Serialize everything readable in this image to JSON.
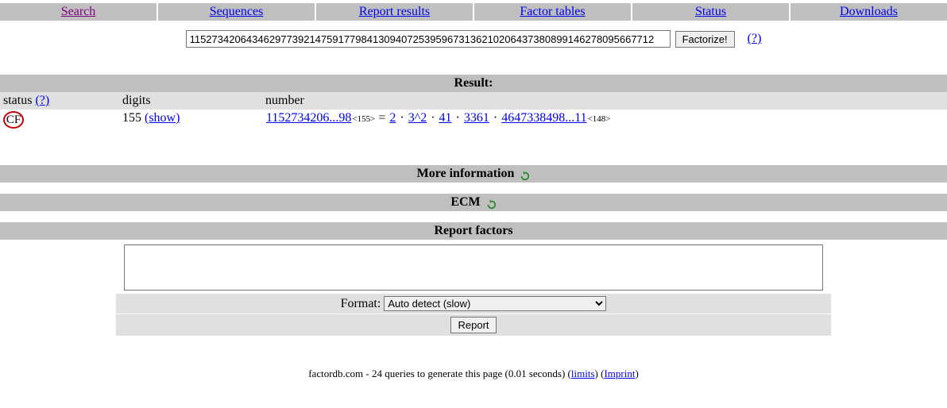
{
  "nav": {
    "search": "Search",
    "sequences": "Sequences",
    "report_results": "Report results",
    "factor_tables": "Factor tables",
    "status": "Status",
    "downloads": "Downloads"
  },
  "search": {
    "value": "115273420643462977392147591779841309407253959673136210206437380899146278095667712",
    "button": "Factorize!",
    "help": "(?)"
  },
  "result": {
    "heading": "Result:",
    "cols": {
      "status": "status",
      "status_help": "(?)",
      "digits": "digits",
      "number": "number"
    },
    "row": {
      "cf": "CF",
      "digits": "155",
      "show": "(show)",
      "num_prefix": "1152734206...98",
      "num_sub": "<155>",
      "eq": " = ",
      "f1": "2",
      "dot": " · ",
      "f2": "3^2",
      "f3": "41",
      "f4": "3361",
      "f5": "4647338498...11",
      "f5_sub": "<148>"
    }
  },
  "more_info": "More information",
  "ecm": "ECM",
  "report_factors": {
    "heading": "Report factors",
    "format_label": "Format: ",
    "format_selected": "Auto detect (slow)",
    "button": "Report"
  },
  "footer": {
    "text1": "factordb.com - 24 queries to generate this page (0.01 seconds) (",
    "limits": "limits",
    "text2": ") (",
    "imprint": "Imprint",
    "text3": ")"
  }
}
